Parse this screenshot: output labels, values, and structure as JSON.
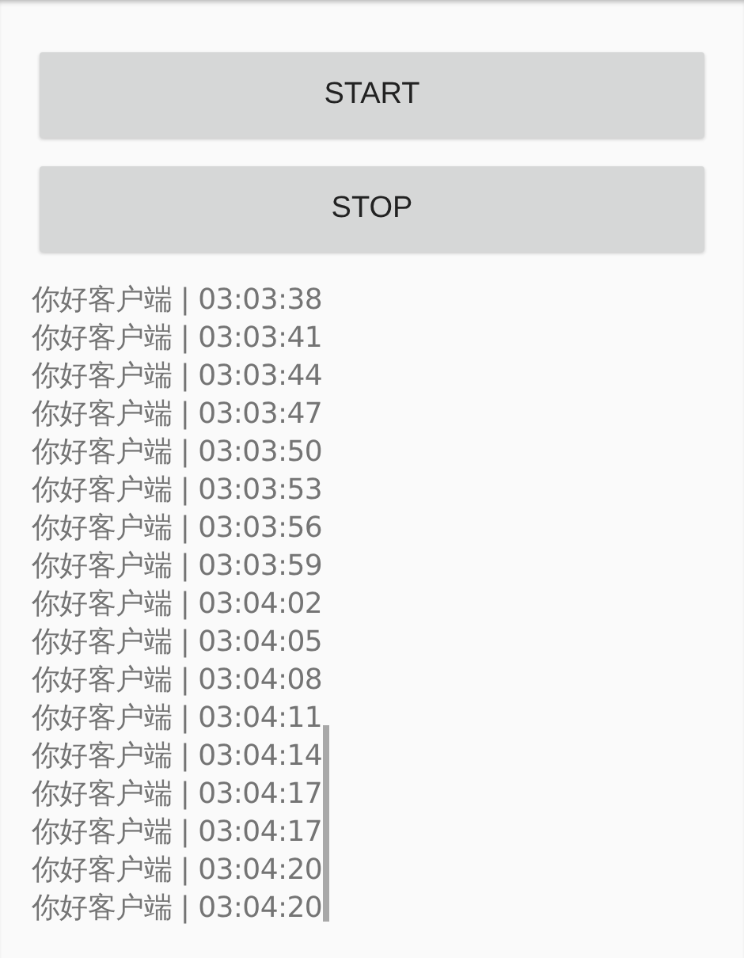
{
  "buttons": [
    {
      "label": "START"
    },
    {
      "label": "STOP"
    }
  ],
  "log": [
    "你好客户端 | 03:03:38",
    "你好客户端 | 03:03:41",
    "你好客户端 | 03:03:44",
    "你好客户端 | 03:03:47",
    "你好客户端 | 03:03:50",
    "你好客户端 | 03:03:53",
    "你好客户端 | 03:03:56",
    "你好客户端 | 03:03:59",
    "你好客户端 | 03:04:02",
    "你好客户端 | 03:04:05",
    "你好客户端 | 03:04:08",
    "你好客户端 | 03:04:11",
    "你好客户端 | 03:04:14",
    "你好客户端 | 03:04:17",
    "你好客户端 | 03:04:17",
    "你好客户端 | 03:04:20",
    "你好客户端 | 03:04:20"
  ]
}
